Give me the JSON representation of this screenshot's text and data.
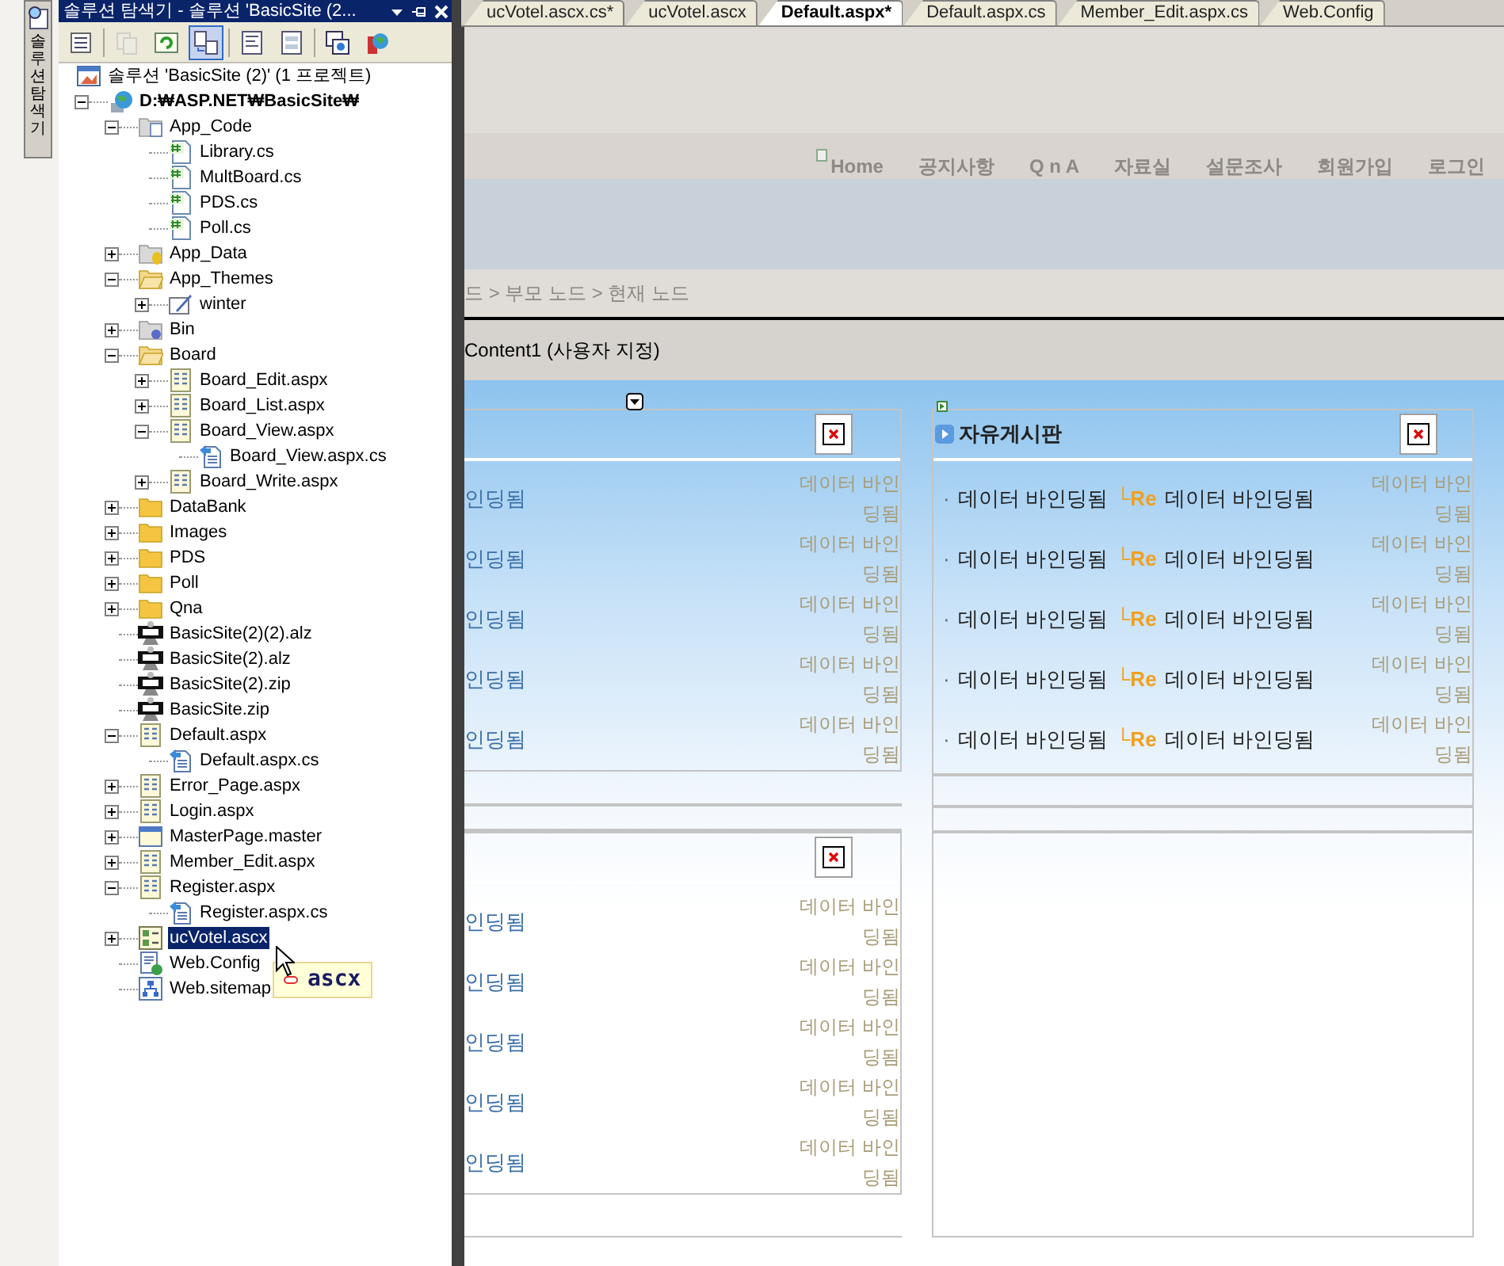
{
  "side_tab": {
    "label": "솔루션 탐색기"
  },
  "explorer": {
    "title": "솔루션 탐색기 - 솔루션 'BasicSite (2...",
    "toolbar": [
      {
        "kind": "properties",
        "pressed": false,
        "disabled": false
      },
      {
        "kind": "copy",
        "pressed": false,
        "disabled": true
      },
      {
        "kind": "refresh",
        "pressed": false,
        "disabled": false
      },
      {
        "kind": "nest",
        "pressed": true,
        "disabled": false
      },
      {
        "kind": "code",
        "pressed": false,
        "disabled": false
      },
      {
        "kind": "designer",
        "pressed": false,
        "disabled": false
      },
      {
        "kind": "window",
        "pressed": false,
        "disabled": false
      },
      {
        "kind": "globe",
        "pressed": false,
        "disabled": false
      }
    ],
    "tree": [
      {
        "label": "솔루션 'BasicSite (2)' (1 프로젝트)",
        "kind": "solution",
        "selected": false,
        "children": [
          {
            "label": "D:₩ASP.NET₩BasicSite₩",
            "kind": "project",
            "bold": true,
            "selected": false,
            "expanded": true,
            "children": [
              {
                "label": "App_Code",
                "kind": "folder-code",
                "selected": false,
                "expanded": true,
                "children": [
                  {
                    "label": "Library.cs",
                    "kind": "cs",
                    "selected": false
                  },
                  {
                    "label": "MultBoard.cs",
                    "kind": "cs",
                    "selected": false
                  },
                  {
                    "label": "PDS.cs",
                    "kind": "cs",
                    "selected": false
                  },
                  {
                    "label": "Poll.cs",
                    "kind": "cs",
                    "selected": false
                  }
                ]
              },
              {
                "label": "App_Data",
                "kind": "folder-data",
                "selected": false,
                "expanded": false
              },
              {
                "label": "App_Themes",
                "kind": "folder-open",
                "selected": false,
                "expanded": true,
                "children": [
                  {
                    "label": "winter",
                    "kind": "theme",
                    "selected": false,
                    "expanded": false
                  }
                ]
              },
              {
                "label": "Bin",
                "kind": "folder-bin",
                "selected": false,
                "expanded": false
              },
              {
                "label": "Board",
                "kind": "folder-open",
                "selected": false,
                "expanded": true,
                "children": [
                  {
                    "label": "Board_Edit.aspx",
                    "kind": "aspx",
                    "selected": false,
                    "expanded": false
                  },
                  {
                    "label": "Board_List.aspx",
                    "kind": "aspx",
                    "selected": false,
                    "expanded": false
                  },
                  {
                    "label": "Board_View.aspx",
                    "kind": "aspx",
                    "selected": false,
                    "expanded": true,
                    "children": [
                      {
                        "label": "Board_View.aspx.cs",
                        "kind": "codebehind",
                        "selected": false
                      }
                    ]
                  },
                  {
                    "label": "Board_Write.aspx",
                    "kind": "aspx",
                    "selected": false,
                    "expanded": false
                  }
                ]
              },
              {
                "label": "DataBank",
                "kind": "folder",
                "selected": false,
                "expanded": false
              },
              {
                "label": "Images",
                "kind": "folder",
                "selected": false,
                "expanded": false
              },
              {
                "label": "PDS",
                "kind": "folder",
                "selected": false,
                "expanded": false
              },
              {
                "label": "Poll",
                "kind": "folder",
                "selected": false,
                "expanded": false
              },
              {
                "label": "Qna",
                "kind": "folder",
                "selected": false,
                "expanded": false
              },
              {
                "label": "BasicSite(2)(2).alz",
                "kind": "archive",
                "selected": false
              },
              {
                "label": "BasicSite(2).alz",
                "kind": "archive",
                "selected": false
              },
              {
                "label": "BasicSite(2).zip",
                "kind": "archive",
                "selected": false
              },
              {
                "label": "BasicSite.zip",
                "kind": "archive",
                "selected": false
              },
              {
                "label": "Default.aspx",
                "kind": "aspx",
                "selected": false,
                "expanded": true,
                "children": [
                  {
                    "label": "Default.aspx.cs",
                    "kind": "codebehind",
                    "selected": false
                  }
                ]
              },
              {
                "label": "Error_Page.aspx",
                "kind": "aspx",
                "selected": false,
                "expanded": false
              },
              {
                "label": "Login.aspx",
                "kind": "aspx",
                "selected": false,
                "expanded": false
              },
              {
                "label": "MasterPage.master",
                "kind": "master",
                "selected": false,
                "expanded": false
              },
              {
                "label": "Member_Edit.aspx",
                "kind": "aspx",
                "selected": false,
                "expanded": false
              },
              {
                "label": "Register.aspx",
                "kind": "aspx",
                "selected": false,
                "expanded": true,
                "children": [
                  {
                    "label": "Register.aspx.cs",
                    "kind": "codebehind",
                    "selected": false
                  }
                ]
              },
              {
                "label": "ucVotel.ascx",
                "kind": "ascx",
                "selected": true,
                "expanded": false
              },
              {
                "label": "Web.Config",
                "kind": "config",
                "selected": false
              },
              {
                "label": "Web.sitemap",
                "kind": "sitemap",
                "selected": false
              }
            ]
          }
        ]
      }
    ],
    "tooltip": {
      "text": "ascx"
    }
  },
  "tabs": [
    {
      "label": "ucVotel.ascx.cs*",
      "selected": false
    },
    {
      "label": "ucVotel.ascx",
      "selected": false
    },
    {
      "label": "Default.aspx*",
      "selected": true
    },
    {
      "label": "Default.aspx.cs",
      "selected": false
    },
    {
      "label": "Member_Edit.aspx.cs",
      "selected": false
    },
    {
      "label": "Web.Config",
      "selected": false
    }
  ],
  "design": {
    "nav": [
      "Home",
      "공지사항",
      "Q n A",
      "자료실",
      "설문조사",
      "회원가입",
      "로그인"
    ],
    "breadcrumb": "드 > 부모 노드 > 현재 노드",
    "content_label": "Content1 (사용자 지정)",
    "left_panels": [
      {
        "rows": [
          {
            "title": "인딩됨",
            "date": "데이터 바인딩됨"
          },
          {
            "title": "인딩됨",
            "date": "데이터 바인딩됨"
          },
          {
            "title": "인딩됨",
            "date": "데이터 바인딩됨"
          },
          {
            "title": "인딩됨",
            "date": "데이터 바인딩됨"
          },
          {
            "title": "인딩됨",
            "date": "데이터 바인딩됨"
          }
        ]
      },
      {
        "rows": [
          {
            "title": "인딩됨",
            "date": "데이터 바인딩됨"
          },
          {
            "title": "인딩됨",
            "date": "데이터 바인딩됨"
          },
          {
            "title": "인딩됨",
            "date": "데이터 바인딩됨"
          },
          {
            "title": "인딩됨",
            "date": "데이터 바인딩됨"
          },
          {
            "title": "인딩됨",
            "date": "데이터 바인딩됨"
          }
        ]
      }
    ],
    "right_panel": {
      "title": "자유게시판",
      "bullet": "·",
      "rows": [
        {
          "title": "데이터 바인딩됨",
          "reply_mark": "└Re",
          "reply": "데이터 바인딩됨",
          "date": "데이터 바인딩됨"
        },
        {
          "title": "데이터 바인딩됨",
          "reply_mark": "└Re",
          "reply": "데이터 바인딩됨",
          "date": "데이터 바인딩됨"
        },
        {
          "title": "데이터 바인딩됨",
          "reply_mark": "└Re",
          "reply": "데이터 바인딩됨",
          "date": "데이터 바인딩됨"
        },
        {
          "title": "데이터 바인딩됨",
          "reply_mark": "└Re",
          "reply": "데이터 바인딩됨",
          "date": "데이터 바인딩됨"
        },
        {
          "title": "데이터 바인딩됨",
          "reply_mark": "└Re",
          "reply": "데이터 바인딩됨",
          "date": "데이터 바인딩됨"
        }
      ]
    }
  }
}
